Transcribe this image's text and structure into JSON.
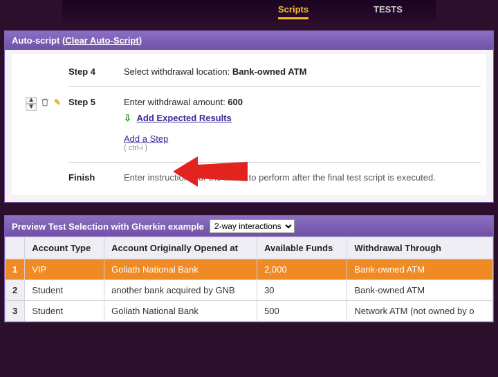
{
  "nav": {
    "item_active": "Scripts",
    "item_tests": "TESTS"
  },
  "autoScript": {
    "title_prefix": "Auto-script (",
    "clear_link": "Clear Auto-Script",
    "title_suffix": ")",
    "step4": {
      "label": "Step 4",
      "text_prefix": "Select withdrawal location: ",
      "value": "Bank-owned ATM"
    },
    "step5": {
      "label": "Step 5",
      "text_prefix": "Enter withdrawal amount: ",
      "value": "600",
      "add_expected": "Add Expected Results",
      "add_step": "Add a Step",
      "add_step_hint": "( ctrl-i )"
    },
    "finish": {
      "label": "Finish",
      "text": "Enter instructions for the tester to perform after the final test script is executed."
    }
  },
  "preview": {
    "title": "Preview Test Selection with Gherkin example",
    "dropdown_value": "2-way interactions",
    "columns": [
      "Account Type",
      "Account Originally Opened at",
      "Available Funds",
      "Withdrawal Through"
    ],
    "rows": [
      {
        "n": "1",
        "cells": [
          "VIP",
          "Goliath National Bank",
          "2,000",
          "Bank-owned ATM"
        ],
        "highlight": true
      },
      {
        "n": "2",
        "cells": [
          "Student",
          "another bank acquired by GNB",
          "30",
          "Bank-owned ATM"
        ],
        "highlight": false
      },
      {
        "n": "3",
        "cells": [
          "Student",
          "Goliath National Bank",
          "500",
          "Network ATM (not owned by o"
        ],
        "highlight": false
      }
    ]
  }
}
